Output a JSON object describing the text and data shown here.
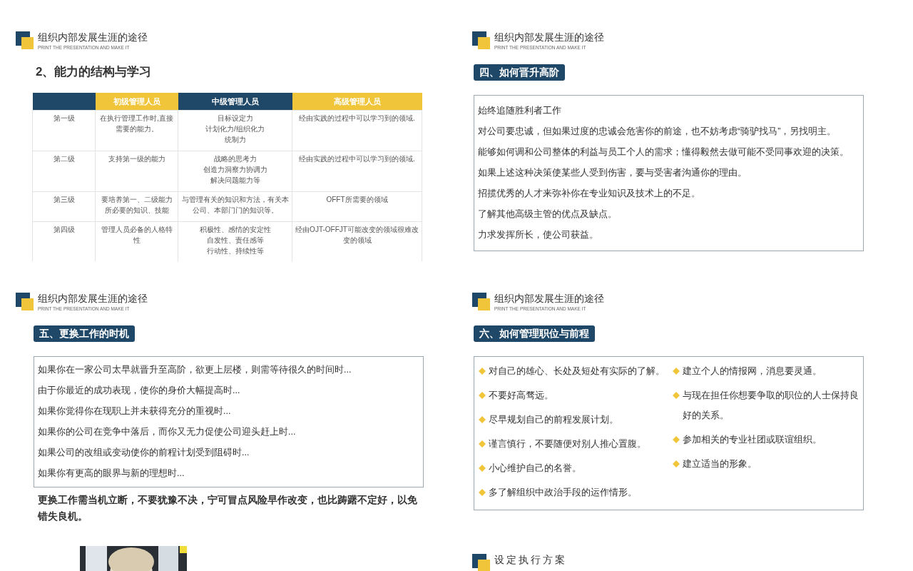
{
  "slides": [
    {
      "kind": "table",
      "header": {
        "title": "组织内部发展生涯的途径",
        "subtitle": "PRINT THE PRESENTATION AND MAKE IT"
      },
      "heading": "2、能力的结构与学习",
      "table": {
        "columns": [
          {
            "color": "#1f4868"
          },
          {
            "label": "初级管理人员",
            "color": "#f0c53a"
          },
          {
            "label": "中级管理人员",
            "color": "#1f4868"
          },
          {
            "label": "高级管理人员",
            "color": "#f0c53a"
          }
        ],
        "rows": [
          [
            [
              "第一级"
            ],
            [
              "在执行管理工作时,直接需要的能力。"
            ],
            [
              "目标设定力",
              "计划化力/组织化力",
              "统制力"
            ],
            [
              "经由实践的过程中可以学习到的领域."
            ]
          ],
          [
            [
              "第二级"
            ],
            [
              "支持第一级的能力"
            ],
            [
              "战略的思考力",
              "创造力洞察力协调力",
              "解决问题能力等"
            ],
            [
              "经由实践的过程中可以学习到的领域."
            ]
          ],
          [
            [
              "第三级"
            ],
            [
              "要培养第一、二级能力所必要的知识、技能"
            ],
            [
              "与管理有关的知识和方法，有关本公司、本部门门的知识等。"
            ],
            [
              "OFFT所需要的领域"
            ]
          ],
          [
            [
              "第四级"
            ],
            [
              "管理人员必备的人格特性"
            ],
            [
              "积极性、感情的安定性",
              "自发性、责任感等",
              "行动性、持续性等"
            ],
            [
              "经由OJT-OFFJT可能改变的领域很难改变的领域"
            ]
          ]
        ]
      }
    },
    {
      "kind": "text_box",
      "header": {
        "title": "组织内部发展生涯的途径",
        "subtitle": "PRINT THE PRESENTATION AND MAKE IT"
      },
      "badge": "四、如何晋升高阶",
      "lines": [
        "始终追随胜利者工作",
        "对公司要忠诚，但如果过度的忠诚会危害你的前途，也不妨考虑“骑驴找马”，另找明主。",
        "能够如何调和公司整体的利益与员工个人的需求；懂得毅然去做可能不受同事欢迎的决策。",
        "如果上述这种决策使某些人受到伤害，要与受害者沟通你的理由。",
        "招揽优秀的人才来弥补你在专业知识及技术上的不足。",
        "了解其他高级主管的优点及缺点。",
        "力求发挥所长，使公司获益。"
      ]
    },
    {
      "kind": "text_box",
      "header": {
        "title": "组织内部发展生涯的途径",
        "subtitle": "PRINT THE PRESENTATION AND MAKE IT"
      },
      "badge": "五、更换工作的时机",
      "lines": [
        "如果你在一家公司太早就晋升至高阶，欲更上层楼，则需等待很久的时间时...",
        "由于你最近的成功表现，使你的身价大幅提高时...",
        "如果你觉得你在现职上并未获得充分的重视时...",
        "如果你的公司在竞争中落后，而你又无力促使公司迎头赶上时...",
        "如果公司的改组或变动使你的前程计划受到阻碍时...",
        "如果你有更高的眼界与新的理想时..."
      ],
      "note": "更换工作需当机立断，不要犹豫不决，宁可冒点风险早作改变，也比踌躇不定好，以免错失良机。"
    },
    {
      "kind": "bullets",
      "header": {
        "title": "组织内部发展生涯的途径",
        "subtitle": "PRINT THE PRESENTATION AND MAKE IT"
      },
      "badge": "六、如何管理职位与前程",
      "columns": [
        [
          "对自己的雄心、长处及短处有实际的了解。",
          "不要好高骛远。",
          "尽早规划自己的前程发展计划。",
          "谨言慎行，不要随便对别人推心置腹。",
          "小心维护自己的名誉。",
          "多了解组织中政治手段的运作情形。"
        ],
        [
          "建立个人的情报网，消息要灵通。",
          "与现在担任你想要争取的职位的人士保持良好的关系。",
          "参加相关的专业社团或联谊组织。",
          "建立适当的形象。"
        ]
      ]
    },
    {
      "kind": "picture"
    },
    {
      "kind": "cover",
      "header": {
        "title": "设定执行方案"
      }
    }
  ]
}
